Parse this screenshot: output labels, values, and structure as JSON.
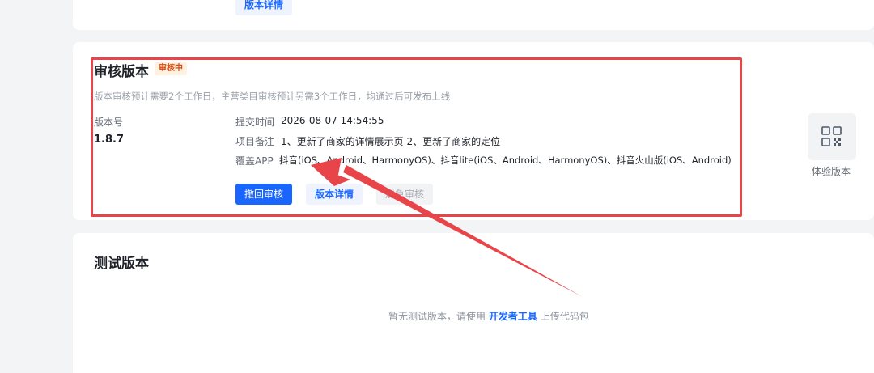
{
  "top_card": {
    "details_button": "版本详情"
  },
  "review": {
    "title": "审核版本",
    "badge": "审核中",
    "description": "版本审核预计需要2个工作日，主营类目审核预计另需3个工作日，均通过后可发布上线",
    "version_label": "版本号",
    "version_value": "1.8.7",
    "submit_time_label": "提交时间",
    "submit_time_value": "2026-08-07 14:54:55",
    "notes_label": "项目备注",
    "notes_value": "1、更新了商家的详情展示页 2、更新了商家的定位",
    "apps_label": "覆盖APP",
    "apps_value": "抖音(iOS、Android、HarmonyOS)、抖音lite(iOS、Android、HarmonyOS)、抖音火山版(iOS、Android)",
    "withdraw_button": "撤回审核",
    "details_button": "版本详情",
    "expedite_button": "加急审核"
  },
  "experience": {
    "label": "体验版本",
    "icon": "qr-code-icon"
  },
  "test": {
    "title": "测试版本",
    "empty_prefix": "暂无测试版本，请使用",
    "empty_link": "开发者工具",
    "empty_suffix": "上传代码包"
  },
  "annotation": {
    "color": "#e8454b"
  }
}
